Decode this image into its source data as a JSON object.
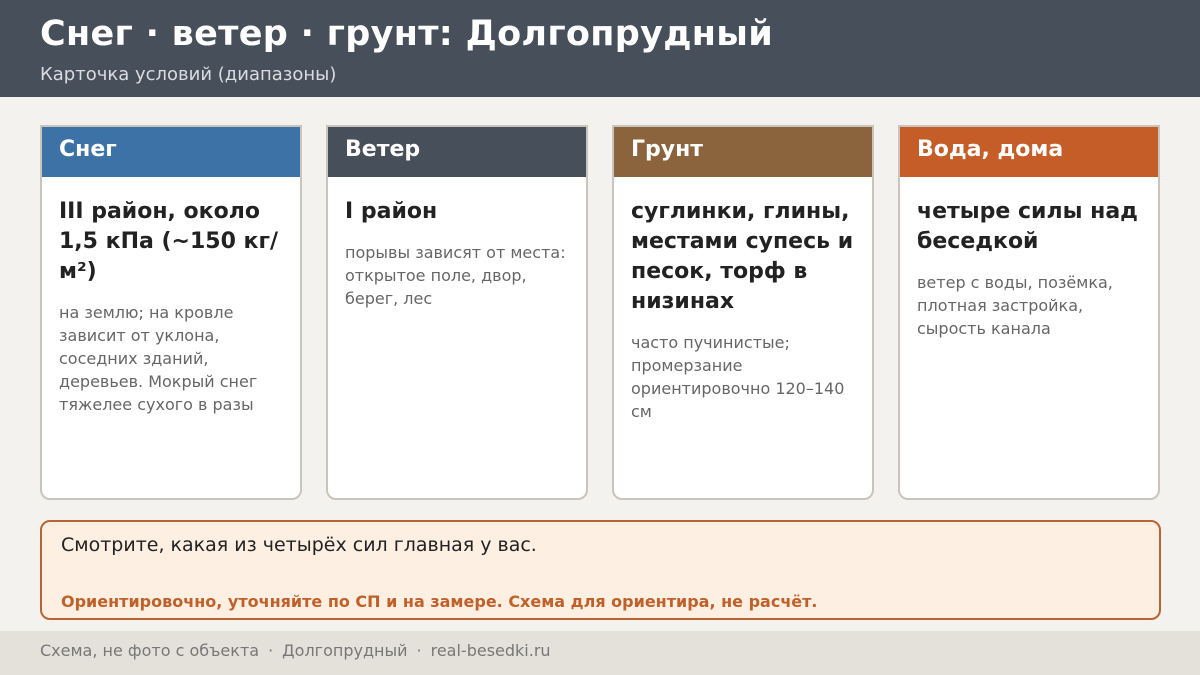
{
  "header": {
    "title": "Снег · ветер · грунт: Долгопрудный",
    "subtitle": "Карточка условий (диапазоны)"
  },
  "cards": [
    {
      "heading": "Снег",
      "main": "III район, около 1,5 кПа (~150 кг/м²)",
      "note": "на землю; на кровле зависит от уклона, соседних зданий, деревьев. Мокрый снег тяжелее сухого в разы",
      "color": "#3d72a6"
    },
    {
      "heading": "Ветер",
      "main": "I район",
      "note": "порывы зависят от места: открытое поле, двор, берег, лес",
      "color": "#474f5b"
    },
    {
      "heading": "Грунт",
      "main": "суглинки, глины, местами супесь и песок, торф в низинах",
      "note": "часто пучинистые; промерзание ориентировочно 120–140 см",
      "color": "#8b633c"
    },
    {
      "heading": "Вода, дома",
      "main": "четыре силы над беседкой",
      "note": "ветер с воды, позёмка, плотная застройка, сырость канала",
      "color": "#c45d28"
    }
  ],
  "notice": {
    "main": "Смотрите, какая из четырёх сил главная у вас.",
    "warning": "Ориентировочно, уточняйте по СП и на замере. Схема для ориентира, не расчёт."
  },
  "footer": {
    "items": [
      "Схема, не фото с объекта",
      "Долгопрудный",
      "real-besedki.ru"
    ],
    "separator": "·"
  }
}
